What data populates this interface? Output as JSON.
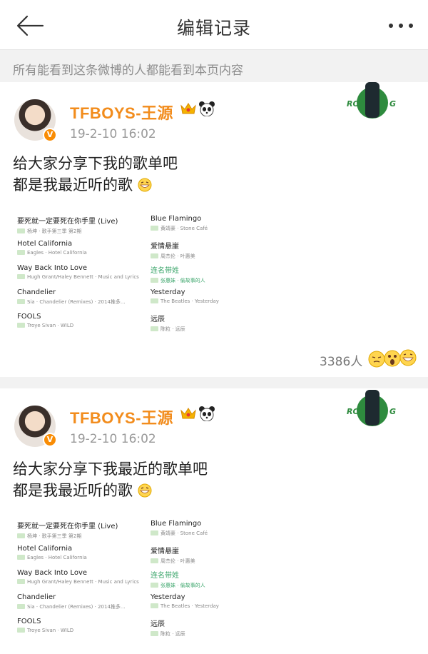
{
  "header": {
    "title": "编辑记录"
  },
  "notice": "所有能看到这条微博的人都能看到本页内容",
  "posts": [
    {
      "author": "TFBOYS-王源",
      "time": "19-2-10 16:02",
      "line1": "给大家分享下我的歌单吧",
      "line2": "都是我最近听的歌",
      "overlay_text": "ROY",
      "overlay_text2": "G",
      "likes": "3386人",
      "songs": [
        {
          "title": "要死就一定要死在你手里 (Live)",
          "sub": "杨坤 · 歌手第三季 第2期"
        },
        {
          "title": "Hotel California",
          "sub": "Eagles · Hotel California"
        },
        {
          "title": "Way Back Into Love",
          "sub": "Hugh Grant/Haley Bennett · Music and Lyrics"
        },
        {
          "title": "Chandelier",
          "sub": "Sia · Chandelier (Remixes) · 2014推多..."
        },
        {
          "title": "FOOLS",
          "sub": "Troye Sivan · WILD"
        },
        {
          "title": "Blue Flamingo",
          "sub": "黄靖豪 · Stone Café"
        },
        {
          "title": "爱情悬崖",
          "sub": "周杰伦 · 叶惠美"
        },
        {
          "title": "连名带姓",
          "sub": "张惠妹 · 偷故事的人"
        },
        {
          "title": "Yesterday",
          "sub": "The Beatles · Yesterday"
        },
        {
          "title": "远辰",
          "sub": "陈粒 · 远辰"
        }
      ]
    },
    {
      "author": "TFBOYS-王源",
      "time": "19-2-10 16:02",
      "line1": "给大家分享下我最近的歌单吧",
      "line2": "都是我最近听的歌",
      "overlay_text": "ROY",
      "overlay_text2": "G",
      "songs": [
        {
          "title": "要死就一定要死在你手里 (Live)",
          "sub": "杨坤 · 歌手第三季 第2期"
        },
        {
          "title": "Hotel California",
          "sub": "Eagles · Hotel California"
        },
        {
          "title": "Way Back Into Love",
          "sub": "Hugh Grant/Haley Bennett · Music and Lyrics"
        },
        {
          "title": "Chandelier",
          "sub": "Sia · Chandelier (Remixes) · 2014推多..."
        },
        {
          "title": "FOOLS",
          "sub": "Troye Sivan · WILD"
        },
        {
          "title": "Blue Flamingo",
          "sub": "黄靖豪 · Stone Café"
        },
        {
          "title": "爱情悬崖",
          "sub": "周杰伦 · 叶惠美"
        },
        {
          "title": "连名带姓",
          "sub": "张惠妹 · 偷故事的人"
        },
        {
          "title": "Yesterday",
          "sub": "The Beatles · Yesterday"
        },
        {
          "title": "远辰",
          "sub": "陈粒 · 远辰"
        }
      ]
    }
  ],
  "colors": {
    "author": "#f28c1c",
    "link_song": "#3aa56a",
    "badge": "#f98c04"
  },
  "icons": {
    "back": "back-arrow-icon",
    "more": "more-dots-icon",
    "crown": "crown-icon",
    "panda": "panda-icon",
    "verified": "verified-badge-icon",
    "grin": "grin-emoji-icon"
  }
}
